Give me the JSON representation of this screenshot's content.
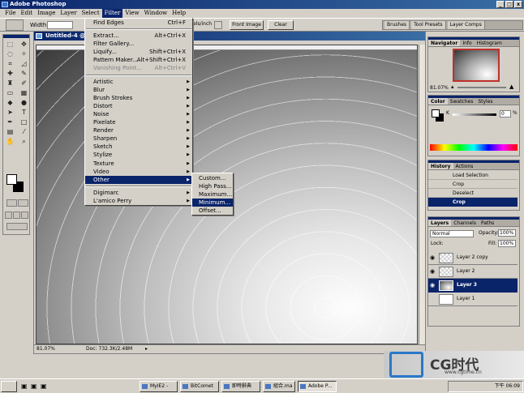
{
  "app": {
    "title": "Adobe Photoshop",
    "window_buttons": [
      "_",
      "□",
      "x"
    ]
  },
  "menubar": [
    "File",
    "Edit",
    "Image",
    "Layer",
    "Select",
    "Filter",
    "View",
    "Window",
    "Help"
  ],
  "options": {
    "width_label": "Width:",
    "unit_text": "els/inch",
    "front_image": "Front Image",
    "clear": "Clear"
  },
  "palette_well": [
    "Brushes",
    "Tool Presets",
    "Layer Comps"
  ],
  "document": {
    "title": "Untitled-4 @",
    "zoom": "81.07%",
    "doc_info": "Doc: 732.3K/2.48M"
  },
  "filter_menu": {
    "top": [
      {
        "label": "Find Edges",
        "shortcut": "Ctrl+F"
      },
      {
        "label": "Extract...",
        "shortcut": "Alt+Ctrl+X"
      },
      {
        "label": "Filter Gallery...",
        "shortcut": ""
      },
      {
        "label": "Liquify...",
        "shortcut": "Shift+Ctrl+X"
      },
      {
        "label": "Pattern Maker...",
        "shortcut": "Alt+Shift+Ctrl+X"
      },
      {
        "label": "Vanishing Point...",
        "shortcut": "Alt+Ctrl+V"
      }
    ],
    "groups": [
      "Artistic",
      "Blur",
      "Brush Strokes",
      "Distort",
      "Noise",
      "Pixelate",
      "Render",
      "Sharpen",
      "Sketch",
      "Stylize",
      "Texture",
      "Video",
      "Other"
    ],
    "plugins": [
      "Digimarc",
      "L'amico Perry"
    ]
  },
  "other_submenu": [
    "Custom...",
    "High Pass...",
    "Maximum...",
    "Minimum...",
    "Offset..."
  ],
  "navigator": {
    "tabs": [
      "Navigator",
      "Info",
      "Histogram"
    ],
    "zoom": "81.07%"
  },
  "color_panel": {
    "tabs": [
      "Color",
      "Swatches",
      "Styles"
    ],
    "k_label": "K",
    "k_value": "0",
    "k_unit": "%"
  },
  "history": {
    "tabs": [
      "History",
      "Actions"
    ],
    "items": [
      "Load Selection",
      "Crop",
      "Deselect",
      "Crop"
    ]
  },
  "layers": {
    "tabs": [
      "Layers",
      "Channels",
      "Paths"
    ],
    "blend_mode": "Normal",
    "opacity_label": "Opacity:",
    "opacity": "100%",
    "lock_label": "Lock:",
    "fill_label": "Fill:",
    "fill": "100%",
    "items": [
      "Layer 2 copy",
      "Layer 2",
      "Layer 3",
      "Layer 1"
    ]
  },
  "taskbar": {
    "buttons": [
      "MyIE2 -",
      "BitComet",
      "即時辭典",
      "組合.ma",
      "Adobe P..."
    ],
    "tray_time": "下午 06:09"
  },
  "watermark": {
    "brand": "CG时代",
    "url": "www.cgtime.cn"
  },
  "colors": {
    "title_start": "#0a246a",
    "title_end": "#3a6ea5",
    "highlight": "#0a246a",
    "chrome": "#d4d0c8"
  }
}
